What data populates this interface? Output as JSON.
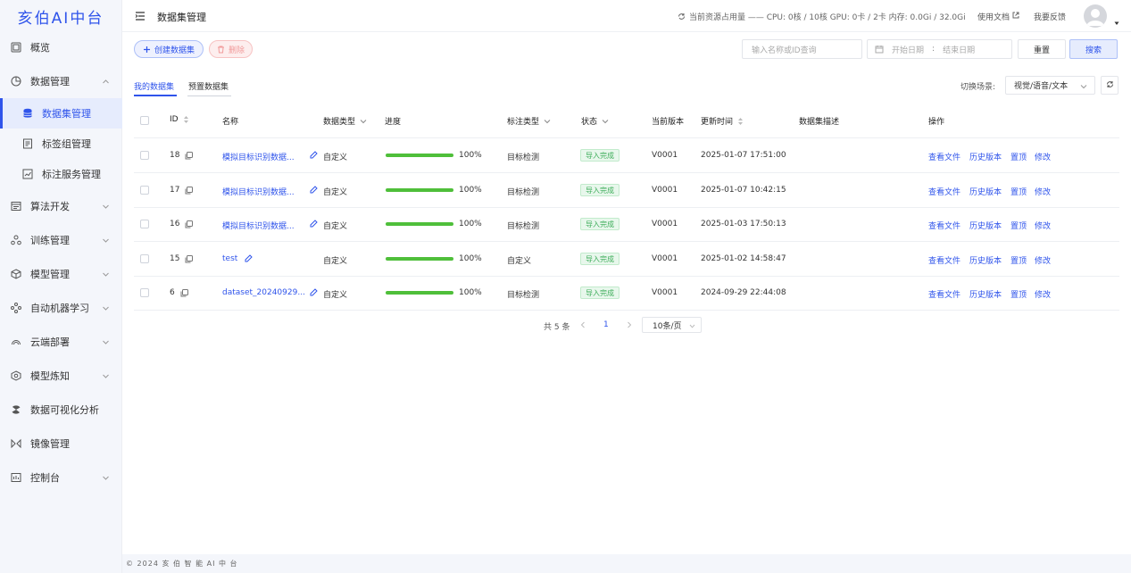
{
  "app": {
    "logo": "亥伯AI中台"
  },
  "sidebar": {
    "items": [
      {
        "label": "概览",
        "icon": "overview-icon"
      },
      {
        "label": "数据管理",
        "icon": "data-icon"
      },
      {
        "label": "数据集管理",
        "icon": "database-icon"
      },
      {
        "label": "标签组管理",
        "icon": "tag-icon"
      },
      {
        "label": "标注服务管理",
        "icon": "annotate-icon"
      },
      {
        "label": "算法开发",
        "icon": "algorithm-icon"
      },
      {
        "label": "训练管理",
        "icon": "training-icon"
      },
      {
        "label": "模型管理",
        "icon": "model-icon"
      },
      {
        "label": "自动机器学习",
        "icon": "automl-icon"
      },
      {
        "label": "云端部署",
        "icon": "cloud-icon"
      },
      {
        "label": "模型炼知",
        "icon": "knowledge-icon"
      },
      {
        "label": "数据可视化分析",
        "icon": "visualize-icon"
      },
      {
        "label": "镜像管理",
        "icon": "image-icon"
      },
      {
        "label": "控制台",
        "icon": "console-icon"
      }
    ]
  },
  "header": {
    "title": "数据集管理",
    "resource": "当前资源占用量 —— CPU: 0核 / 10核 GPU: 0卡 / 2卡 内存: 0.0Gi / 32.0Gi",
    "doc_link": "使用文档",
    "feedback": "我要反馈"
  },
  "toolbar": {
    "create_label": "创建数据集",
    "delete_label": "删除",
    "search_placeholder": "输入名称或ID查询",
    "start_date_placeholder": "开始日期",
    "date_separator": ":",
    "end_date_placeholder": "结束日期",
    "reset_label": "重置",
    "search_label": "搜索"
  },
  "tabs": {
    "mine": "我的数据集",
    "preset": "预置数据集",
    "scene_label": "切换场景:",
    "scene_value": "视觉/语音/文本"
  },
  "table": {
    "headers": {
      "id": "ID",
      "name": "名称",
      "data_type": "数据类型",
      "progress": "进度",
      "label_type": "标注类型",
      "status": "状态",
      "version": "当前版本",
      "updated": "更新时间",
      "description": "数据集描述",
      "actions": "操作"
    },
    "rows": [
      {
        "id": "18",
        "name": "模拟目标识别数据...",
        "data_type": "自定义",
        "progress": 1.0,
        "progress_text": "100%",
        "label_type": "目标检测",
        "status": "导入完成",
        "version": "V0001",
        "updated": "2025-01-07 17:51:00",
        "description": ""
      },
      {
        "id": "17",
        "name": "模拟目标识别数据...",
        "data_type": "自定义",
        "progress": 1.0,
        "progress_text": "100%",
        "label_type": "目标检测",
        "status": "导入完成",
        "version": "V0001",
        "updated": "2025-01-07 10:42:15",
        "description": ""
      },
      {
        "id": "16",
        "name": "模拟目标识别数据...",
        "data_type": "自定义",
        "progress": 1.0,
        "progress_text": "100%",
        "label_type": "目标检测",
        "status": "导入完成",
        "version": "V0001",
        "updated": "2025-01-03 17:50:13",
        "description": ""
      },
      {
        "id": "15",
        "name": "test",
        "data_type": "自定义",
        "progress": 1.0,
        "progress_text": "100%",
        "label_type": "自定义",
        "status": "导入完成",
        "version": "V0001",
        "updated": "2025-01-02 14:58:47",
        "description": ""
      },
      {
        "id": "6",
        "name": "dataset_20240929...",
        "data_type": "自定义",
        "progress": 1.0,
        "progress_text": "100%",
        "label_type": "目标检测",
        "status": "导入完成",
        "version": "V0001",
        "updated": "2024-09-29 22:44:08",
        "description": ""
      }
    ],
    "actions": [
      "查看文件",
      "历史版本",
      "置顶",
      "修改"
    ]
  },
  "pagination": {
    "total": "共 5 条",
    "current_page": "1",
    "page_size": "10条/页"
  },
  "footer": {
    "text": "© 2024 亥 伯 智 能 AI 中 台"
  },
  "colors": {
    "accent": "#2f54eb",
    "success": "#4fbf3a",
    "danger": "#f19b9b"
  }
}
